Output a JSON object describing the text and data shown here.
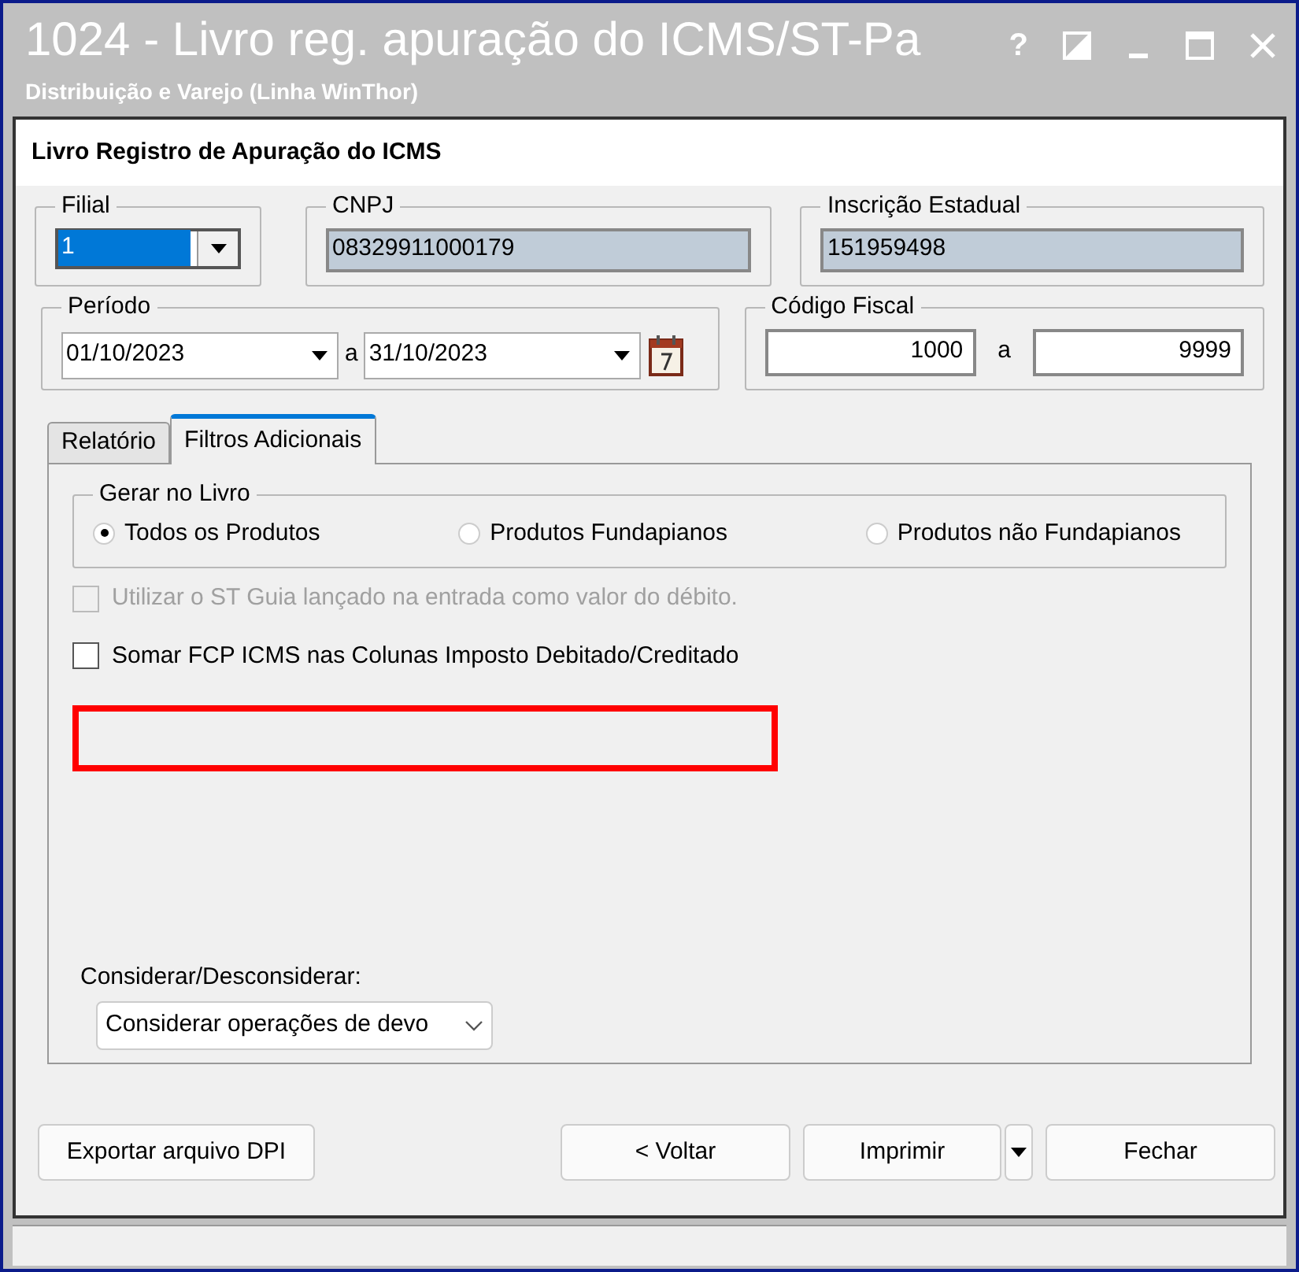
{
  "window": {
    "title": "1024 - Livro reg. apuração do ICMS/ST-Pa",
    "subtitle": "Distribuição e Varejo (Linha WinThor)",
    "help": "?"
  },
  "form_title": "Livro Registro de Apuração do ICMS",
  "filial": {
    "label": "Filial",
    "value": "1",
    "value_selected": true
  },
  "cnpj": {
    "label": "CNPJ",
    "value": "08329911000179",
    "readonly": true
  },
  "inscricao": {
    "label": "Inscrição Estadual",
    "value": "151959498",
    "readonly": true
  },
  "periodo": {
    "label": "Período",
    "from": "01/10/2023",
    "separator": "a",
    "to": "31/10/2023"
  },
  "codigo_fiscal": {
    "label": "Código Fiscal",
    "from": "1000",
    "separator": "a",
    "to": "9999"
  },
  "tabs": [
    {
      "label": "Relatório",
      "selected": false
    },
    {
      "label": "Filtros Adicionais",
      "selected": true
    }
  ],
  "gerar_no_livro": {
    "label": "Gerar no Livro",
    "options": [
      {
        "label": "Todos os Produtos",
        "selected": true
      },
      {
        "label": "Produtos Fundapianos",
        "selected": false
      },
      {
        "label": "Produtos não Fundapianos",
        "selected": false
      }
    ]
  },
  "checkboxes": [
    {
      "label": "Utilizar o ST Guia lançado na entrada como valor do débito.",
      "checked": false,
      "disabled": true
    },
    {
      "label": "Somar FCP ICMS nas Colunas Imposto Debitado/Creditado",
      "checked": false,
      "disabled": false
    }
  ],
  "considerar": {
    "label": "Considerar/Desconsiderar:",
    "value": "Considerar operações de devo"
  },
  "buttons": [
    {
      "label": "Exportar arquivo DPI",
      "kind": "plain"
    },
    {
      "label": "< Voltar",
      "kind": "plain"
    },
    {
      "label": "Imprimir",
      "kind": "split"
    },
    {
      "label": "Fechar",
      "kind": "plain"
    }
  ]
}
